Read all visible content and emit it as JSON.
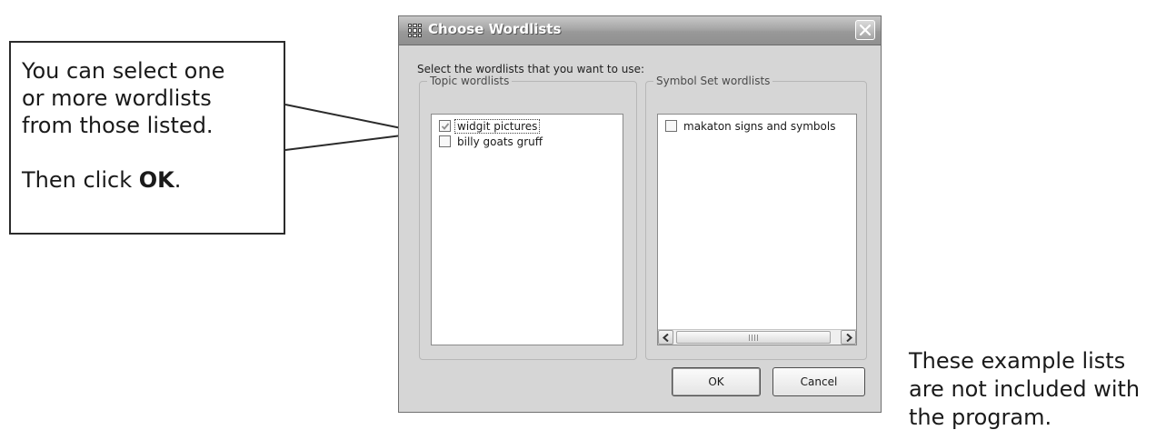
{
  "callout": {
    "lines": [
      "You can select one",
      "or more wordlists",
      "from those listed."
    ],
    "then_prefix": "Then click ",
    "then_bold": "OK",
    "then_suffix": "."
  },
  "note": {
    "lines": [
      "These example lists",
      "are not included with",
      "the program."
    ]
  },
  "dialog": {
    "title": "Choose Wordlists",
    "instruction": "Select the wordlists that you want to use:",
    "topic_group": {
      "label": "Topic wordlists",
      "items": [
        {
          "label": "widgit pictures",
          "checked": true
        },
        {
          "label": "billy goats gruff",
          "checked": false
        }
      ]
    },
    "symbol_group": {
      "label": "Symbol Set wordlists",
      "items": [
        {
          "label": "makaton signs and symbols",
          "checked": false
        }
      ]
    },
    "buttons": {
      "ok": "OK",
      "cancel": "Cancel"
    }
  },
  "icons": {
    "app": "wordlist-grid-icon",
    "close": "close-icon",
    "scroll_left": "chevron-left-icon",
    "scroll_right": "chevron-right-icon",
    "check": "checkmark-icon"
  },
  "colors": {
    "titlebar": "#9a9a9a",
    "dialog_bg": "#d6d6d6",
    "check": "#8f8f8f"
  }
}
